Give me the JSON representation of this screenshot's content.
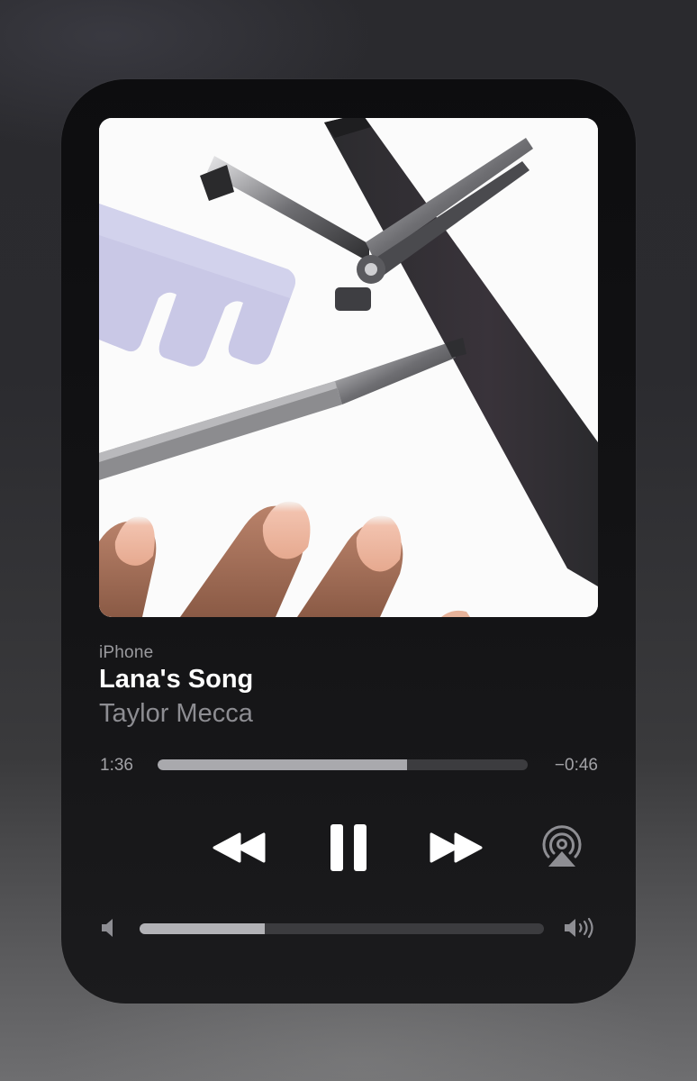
{
  "player": {
    "source": "iPhone",
    "title": "Lana's Song",
    "artist": "Taylor Mecca",
    "elapsed": "1:36",
    "remaining": "−0:46",
    "progress": 0.674,
    "volume": 0.31,
    "state": "playing"
  },
  "icons": {
    "rewind": "backward-icon",
    "pause": "pause-icon",
    "forward": "forward-icon",
    "airplay": "airplay-audio-icon",
    "volume_low": "speaker-low-icon",
    "volume_high": "speaker-high-icon"
  },
  "colors": {
    "card_background": "#121214",
    "title": "#ffffff",
    "secondary_text": "#8d8d92",
    "track_fill": "#a9a9ad",
    "track_background": "#3c3c3f"
  }
}
